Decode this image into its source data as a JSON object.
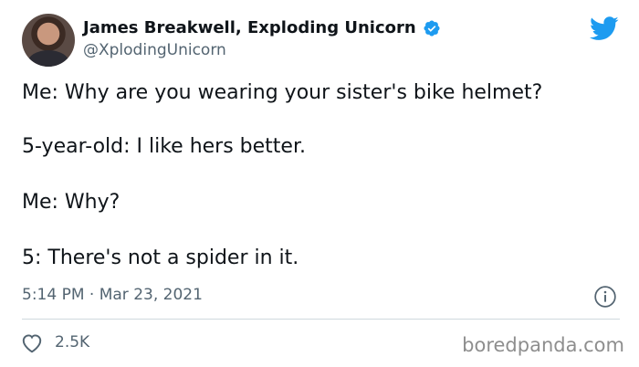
{
  "author": {
    "display_name": "James Breakwell, Exploding Unicorn",
    "handle": "@XplodingUnicorn",
    "verified": true
  },
  "tweet": {
    "lines": [
      "Me: Why are you wearing your sister's bike helmet?",
      "5-year-old: I like hers better.",
      "Me: Why?",
      "5: There's not a spider in it."
    ],
    "timestamp": "5:14 PM · Mar 23, 2021"
  },
  "engagement": {
    "likes": "2.5K"
  },
  "watermark": "boredpanda.com",
  "icons": {
    "brand": "twitter-bird-icon",
    "verified": "verified-badge-icon",
    "info": "info-icon",
    "like": "heart-icon"
  },
  "colors": {
    "twitter_blue": "#1d9bf0",
    "secondary_text": "#536471",
    "divider": "#cfd9de"
  }
}
